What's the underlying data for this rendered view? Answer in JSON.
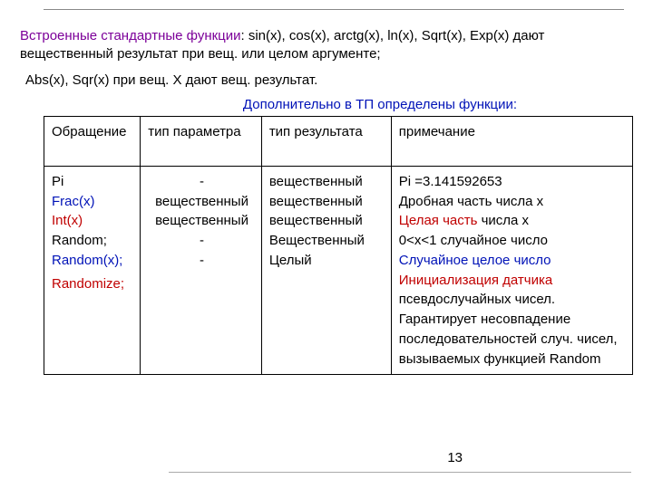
{
  "intro": {
    "tag": "Встроенные стандартные функции",
    "rest": ": sin(x), cos(x), arctg(x), ln(x), Sqrt(x), Exp(x) дают вещественный результат при вещ. или целом аргументе;"
  },
  "line2": "Abs(x), Sqr(x) при вещ. X дают вещ. результат.",
  "caption": "Дополнительно в ТП определены функции:",
  "head": {
    "c0": "Обращение",
    "c1": "тип параметра",
    "c2": "тип результата",
    "c3": "примечание"
  },
  "col0": {
    "r0": "Pi",
    "r1": "Frac(x)",
    "r2": "Int(x)",
    "r3": "Random;",
    "r4": "Random(x);",
    "r5": "Randomize;"
  },
  "col1": {
    "r0": "-",
    "r1": "вещественный",
    "r2": "вещественный",
    "r3": "-",
    "r4": " ",
    "r5": "-"
  },
  "col2": {
    "r0": "вещественный",
    "r1": "вещественный",
    "r2": "вещественный",
    "r3": "Вещественный",
    "r4": "Целый"
  },
  "col3": {
    "r0": "Pi =3.141592653",
    "r1": "Дробная часть числа x",
    "r2a": "Целая часть",
    "r2b": " числа x",
    "r3": "0<x<1  случайное число",
    "r4": "Случайное целое число",
    "r5": "Инициализация датчика",
    "r6": "псевдослучайных чисел.",
    "r7": "Гарантирует несовпадение",
    "r8": "последовательностей случ. чисел, вызываемых функцией Random"
  },
  "page": "13"
}
